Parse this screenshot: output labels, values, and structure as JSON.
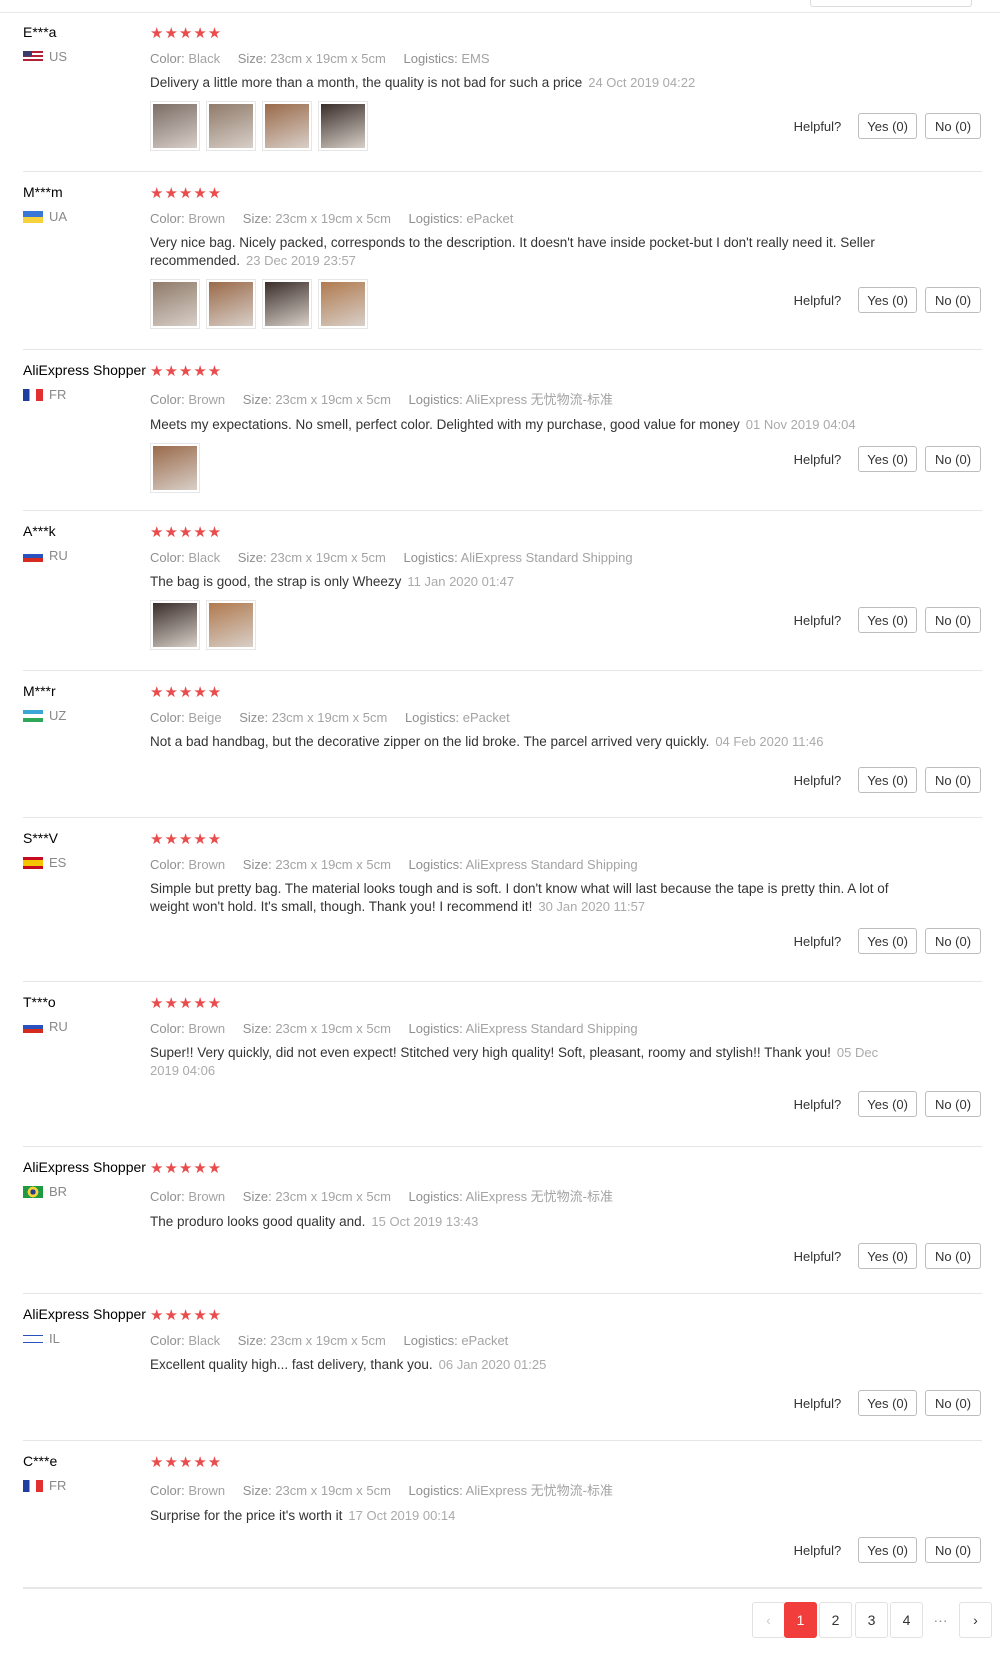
{
  "labels": {
    "color": "Color:",
    "size": "Size:",
    "logistics": "Logistics:",
    "helpful": "Helpful?"
  },
  "reviews": [
    {
      "name": "E***a",
      "country": "US",
      "stars": "★★★★★",
      "color": "Black",
      "size": "23cm x 19cm x 5cm",
      "logistics": "EMS",
      "text": "Delivery a little more than a month, the quality is not bad for such a price",
      "date": "24 Oct 2019 04:22",
      "yes": "Yes (0)",
      "no": "No (0)",
      "pics": 4
    },
    {
      "name": "M***m",
      "country": "UA",
      "stars": "★★★★★",
      "color": "Brown",
      "size": "23cm x 19cm x 5cm",
      "logistics": "ePacket",
      "text": "Very nice bag. Nicely packed, corresponds to the description. It doesn't have inside pocket-but I don't really need it. Seller recommended.",
      "date": "23 Dec 2019 23:57",
      "yes": "Yes (0)",
      "no": "No (0)",
      "pics": 4
    },
    {
      "name": "AliExpress Shopper",
      "country": "FR",
      "stars": "★★★★★",
      "color": "Brown",
      "size": "23cm x 19cm x 5cm",
      "logistics": "AliExpress 无忧物流-标准",
      "text": "Meets my expectations. No smell, perfect color. Delighted with my purchase, good value for money",
      "date": "01 Nov 2019 04:04",
      "yes": "Yes (0)",
      "no": "No (0)",
      "pics": 1
    },
    {
      "name": "A***k",
      "country": "RU",
      "stars": "★★★★★",
      "color": "Black",
      "size": "23cm x 19cm x 5cm",
      "logistics": "AliExpress Standard Shipping",
      "text": "The bag is good, the strap is only Wheezy",
      "date": "11 Jan 2020 01:47",
      "yes": "Yes (0)",
      "no": "No (0)",
      "pics": 2
    },
    {
      "name": "M***r",
      "country": "UZ",
      "stars": "★★★★★",
      "color": "Beige",
      "size": "23cm x 19cm x 5cm",
      "logistics": "ePacket",
      "text": "Not a bad handbag, but the decorative zipper on the lid broke. The parcel arrived very quickly.",
      "date": "04 Feb 2020 11:46",
      "yes": "Yes (0)",
      "no": "No (0)",
      "pics": 0
    },
    {
      "name": "S***V",
      "country": "ES",
      "stars": "★★★★★",
      "color": "Brown",
      "size": "23cm x 19cm x 5cm",
      "logistics": "AliExpress Standard Shipping",
      "text": "Simple but pretty bag. The material looks tough and is soft. I don't know what will last because the tape is pretty thin. A lot of weight won't hold. It's small, though. Thank you! I recommend it!",
      "date": "30 Jan 2020 11:57",
      "yes": "Yes (0)",
      "no": "No (0)",
      "pics": 0
    },
    {
      "name": "T***o",
      "country": "RU",
      "stars": "★★★★★",
      "color": "Brown",
      "size": "23cm x 19cm x 5cm",
      "logistics": "AliExpress Standard Shipping",
      "text": "Super!! Very quickly, did not even expect! Stitched very high quality! Soft, pleasant, roomy and stylish!! Thank you!",
      "date": "05 Dec 2019 04:06",
      "yes": "Yes (0)",
      "no": "No (0)",
      "pics": 0
    },
    {
      "name": "AliExpress Shopper",
      "country": "BR",
      "stars": "★★★★★",
      "color": "Brown",
      "size": "23cm x 19cm x 5cm",
      "logistics": "AliExpress 无忧物流-标准",
      "text": "The produro looks good quality and.",
      "date": "15 Oct 2019 13:43",
      "yes": "Yes (0)",
      "no": "No (0)",
      "pics": 0
    },
    {
      "name": "AliExpress Shopper",
      "country": "IL",
      "stars": "★★★★★",
      "color": "Black",
      "size": "23cm x 19cm x 5cm",
      "logistics": "ePacket",
      "text": "Excellent quality high... fast delivery, thank you.",
      "date": "06 Jan 2020 01:25",
      "yes": "Yes (0)",
      "no": "No (0)",
      "pics": 0
    },
    {
      "name": "C***e",
      "country": "FR",
      "stars": "★★★★★",
      "color": "Brown",
      "size": "23cm x 19cm x 5cm",
      "logistics": "AliExpress 无忧物流-标准",
      "text": "Surprise for the price it's worth it",
      "date": "17 Oct 2019 00:14",
      "yes": "Yes (0)",
      "no": "No (0)",
      "pics": 0
    }
  ],
  "pagination": {
    "prev": "‹",
    "pages": [
      "1",
      "2",
      "3",
      "4"
    ],
    "current": "1",
    "ellipsis": "···",
    "next": "›"
  },
  "colors": {
    "star": "#e94c4c",
    "active_page": "#f23d3d"
  }
}
